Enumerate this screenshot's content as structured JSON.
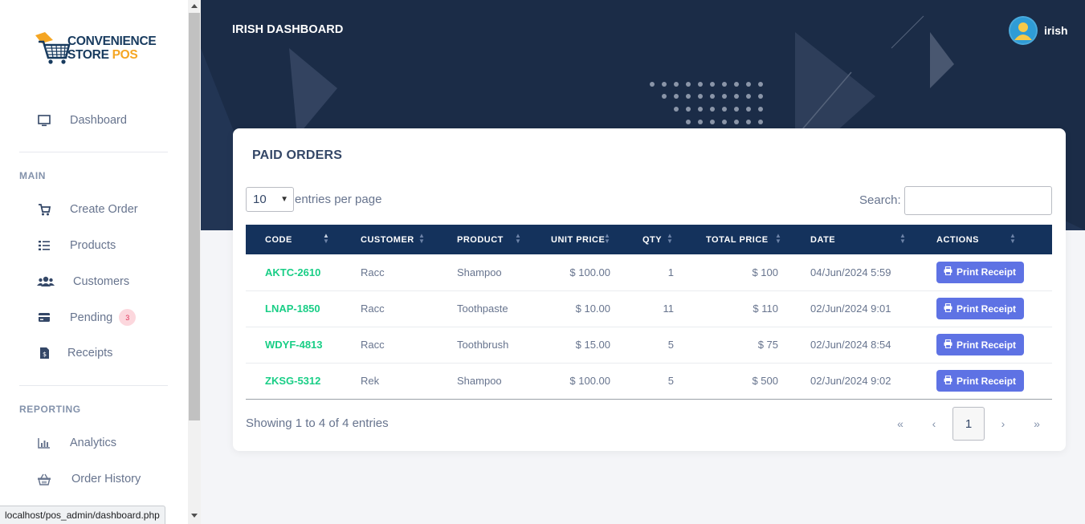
{
  "sidebar": {
    "logo": {
      "line1": "CONVENIENCE",
      "line2a": "STORE ",
      "line2b": "POS"
    },
    "dashboard": "Dashboard",
    "section_main": "MAIN",
    "items_main": [
      {
        "label": "Create Order",
        "icon": "cart-icon"
      },
      {
        "label": "Products",
        "icon": "list-icon"
      },
      {
        "label": "Customers",
        "icon": "users-icon"
      },
      {
        "label": "Pending",
        "icon": "card-icon",
        "badge": "3"
      },
      {
        "label": "Receipts",
        "icon": "invoice-icon"
      }
    ],
    "section_reporting": "REPORTING",
    "items_reporting": [
      {
        "label": "Analytics",
        "icon": "chart-icon"
      },
      {
        "label": "Order History",
        "icon": "basket-icon"
      }
    ]
  },
  "header": {
    "title": "IRISH DASHBOARD",
    "user": "irish"
  },
  "card": {
    "title": "PAID ORDERS",
    "page_length": "10",
    "length_label": "entries per page",
    "search_label": "Search:",
    "search_value": "",
    "columns": [
      "CODE",
      "CUSTOMER",
      "PRODUCT",
      "UNIT PRICE",
      "QTY",
      "TOTAL PRICE",
      "DATE",
      "ACTIONS"
    ],
    "rows": [
      {
        "code": "AKTC-2610",
        "customer": "Racc",
        "product": "Shampoo",
        "unit_price": "$ 100.00",
        "qty": "1",
        "total": "$ 100",
        "date": "04/Jun/2024 5:59",
        "action": "Print Receipt"
      },
      {
        "code": "LNAP-1850",
        "customer": "Racc",
        "product": "Toothpaste",
        "unit_price": "$ 10.00",
        "qty": "11",
        "total": "$ 110",
        "date": "02/Jun/2024 9:01",
        "action": "Print Receipt"
      },
      {
        "code": "WDYF-4813",
        "customer": "Racc",
        "product": "Toothbrush",
        "unit_price": "$ 15.00",
        "qty": "5",
        "total": "$ 75",
        "date": "02/Jun/2024 8:54",
        "action": "Print Receipt"
      },
      {
        "code": "ZKSG-5312",
        "customer": "Rek",
        "product": "Shampoo",
        "unit_price": "$ 100.00",
        "qty": "5",
        "total": "$ 500",
        "date": "02/Jun/2024 9:02",
        "action": "Print Receipt"
      }
    ],
    "info": "Showing 1 to 4 of 4 entries",
    "pager": {
      "first": "«",
      "prev": "‹",
      "current": "1",
      "next": "›",
      "last": "»"
    }
  },
  "status_bar": {
    "url": "localhost/pos_admin/dashboard.php"
  },
  "colors": {
    "accent": "#5e72e4",
    "code_green": "#19ce86",
    "hero_bg": "#1b2c47",
    "table_head": "#14325c"
  }
}
